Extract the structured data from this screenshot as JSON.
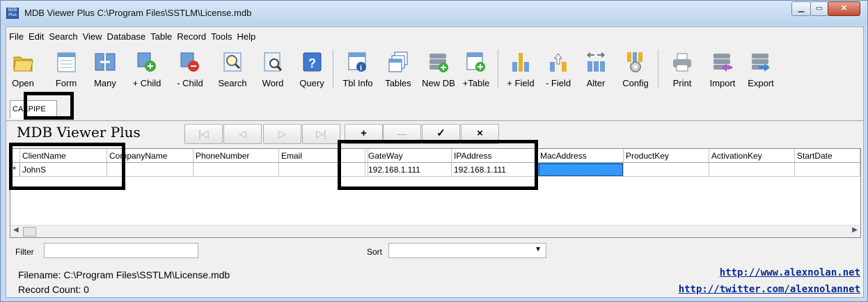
{
  "window": {
    "title": "MDB Viewer Plus C:\\Program Files\\SSTLM\\License.mdb",
    "app_icon": "MDB Plus",
    "controls": [
      "minimize",
      "maximize",
      "close"
    ]
  },
  "menu": [
    "File",
    "Edit",
    "Search",
    "View",
    "Database",
    "Table",
    "Record",
    "Tools",
    "Help"
  ],
  "toolbar": [
    {
      "label": "Open",
      "icon": "folder-icon"
    },
    {
      "label": "Form",
      "icon": "form-icon"
    },
    {
      "label": "Many",
      "icon": "many-icon"
    },
    {
      "label": "+ Child",
      "icon": "add-child-icon"
    },
    {
      "label": "- Child",
      "icon": "remove-child-icon"
    },
    {
      "label": "Search",
      "icon": "search-icon"
    },
    {
      "label": "Word",
      "icon": "word-search-icon"
    },
    {
      "label": "Query",
      "icon": "query-icon"
    },
    {
      "label": "Tbl Info",
      "icon": "table-info-icon"
    },
    {
      "label": "Tables",
      "icon": "tables-icon"
    },
    {
      "label": "New DB",
      "icon": "new-db-icon"
    },
    {
      "label": "+Table",
      "icon": "add-table-icon"
    },
    {
      "label": "+ Field",
      "icon": "add-field-icon"
    },
    {
      "label": "- Field",
      "icon": "remove-field-icon"
    },
    {
      "label": "Alter",
      "icon": "alter-icon"
    },
    {
      "label": "Config",
      "icon": "config-icon"
    },
    {
      "label": "Print",
      "icon": "printer-icon"
    },
    {
      "label": "Import",
      "icon": "import-icon"
    },
    {
      "label": "Export",
      "icon": "export-icon"
    }
  ],
  "tabs": [
    {
      "label": "CAEPIPE",
      "active": true
    }
  ],
  "panel": {
    "heading": "MDB Viewer Plus",
    "nav_buttons": [
      {
        "symbol": "|◁",
        "icon": "first-record-icon",
        "enabled": false
      },
      {
        "symbol": "◁",
        "icon": "previous-record-icon",
        "enabled": false
      },
      {
        "symbol": "▷",
        "icon": "next-record-icon",
        "enabled": false
      },
      {
        "symbol": "▷|",
        "icon": "last-record-icon",
        "enabled": false
      },
      {
        "symbol": "+",
        "icon": "add-record-icon",
        "enabled": true
      },
      {
        "symbol": "—",
        "icon": "delete-record-icon",
        "enabled": false
      },
      {
        "symbol": "✓",
        "icon": "save-record-icon",
        "enabled": true
      },
      {
        "symbol": "×",
        "icon": "cancel-record-icon",
        "enabled": true
      }
    ]
  },
  "grid": {
    "columns": [
      "ClientName",
      "CompanyName",
      "PhoneNumber",
      "Email",
      "",
      "GateWay",
      "IPAddress",
      "MacAddress",
      "ProductKey",
      "ActivationKey",
      "StartDate"
    ],
    "rows": [
      {
        "marker": "*",
        "cells": [
          "JohnS",
          "",
          "",
          "",
          "",
          "192.168.1.111",
          "192.168.1.111",
          "",
          "",
          "",
          ""
        ]
      }
    ],
    "selected_column": "MacAddress"
  },
  "filter": {
    "label": "Filter",
    "value": ""
  },
  "sort": {
    "label": "Sort",
    "value": ""
  },
  "status": {
    "filename": "Filename: C:\\Program Files\\SSTLM\\License.mdb",
    "record_count": "Record Count: 0"
  },
  "links": [
    "http://www.alexnolan.net",
    "http://twitter.com/alexnolannet"
  ],
  "colors": {
    "accent": "#3399ff",
    "link": "#0a2a92",
    "highlight_box": "#000000"
  }
}
